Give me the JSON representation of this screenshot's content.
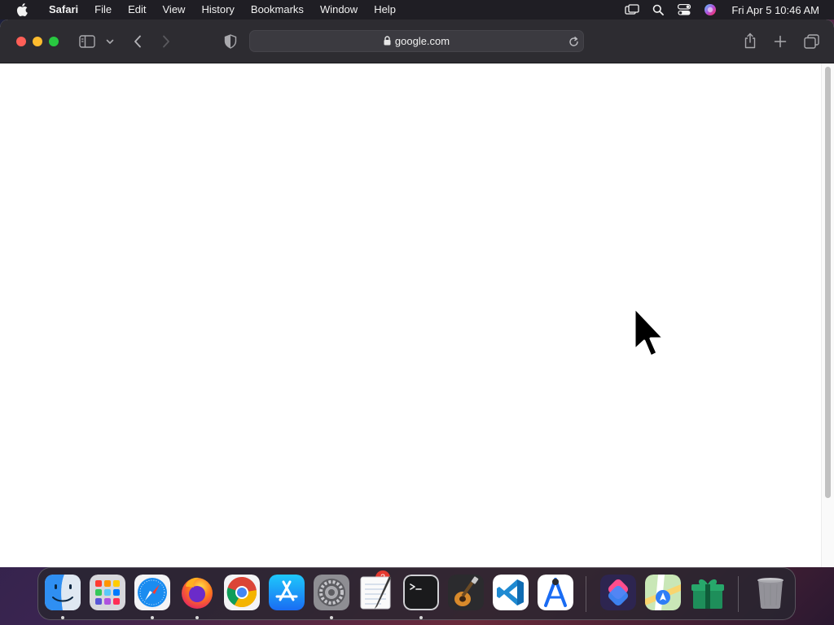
{
  "menubar": {
    "app_name": "Safari",
    "items": [
      "File",
      "Edit",
      "View",
      "History",
      "Bookmarks",
      "Window",
      "Help"
    ],
    "clock": "Fri Apr 5  10:46 AM",
    "status_icons": [
      "screen-mirroring-icon",
      "spotlight-search-icon",
      "control-center-icon",
      "siri-icon"
    ]
  },
  "browser": {
    "url": "google.com",
    "toolbar_icons": [
      "sidebar-icon",
      "chevron-down-icon",
      "back-icon",
      "forward-icon",
      "privacy-shield-icon",
      "reload-icon",
      "share-icon",
      "new-tab-icon",
      "tab-overview-icon"
    ]
  },
  "dock": {
    "apps": [
      {
        "name": "Finder",
        "icon": "finder-icon",
        "running": true
      },
      {
        "name": "Launchpad",
        "icon": "launchpad-icon",
        "running": false
      },
      {
        "name": "Safari",
        "icon": "safari-icon",
        "running": true
      },
      {
        "name": "Firefox",
        "icon": "firefox-icon",
        "running": true
      },
      {
        "name": "Google Chrome",
        "icon": "chrome-icon",
        "running": false
      },
      {
        "name": "App Store",
        "icon": "app-store-icon",
        "running": false
      },
      {
        "name": "System Settings",
        "icon": "system-settings-icon",
        "running": true,
        "badge": "2"
      },
      {
        "name": "TextEdit",
        "icon": "textedit-icon",
        "running": false
      },
      {
        "name": "Terminal",
        "icon": "terminal-icon",
        "running": true
      },
      {
        "name": "GarageBand",
        "icon": "garageband-icon",
        "running": false
      },
      {
        "name": "Visual Studio Code",
        "icon": "vscode-icon",
        "running": false
      },
      {
        "name": "Instruments",
        "icon": "instruments-icon",
        "running": false
      },
      {
        "name": "Shortcuts",
        "icon": "shortcuts-icon",
        "running": false
      },
      {
        "name": "Maps",
        "icon": "maps-icon",
        "running": false
      },
      {
        "name": "Gift",
        "icon": "gift-icon",
        "running": false
      },
      {
        "name": "Trash",
        "icon": "trash-icon",
        "running": false
      }
    ]
  },
  "colors": {
    "close": "#ff5f57",
    "minimize": "#febc2e",
    "zoom": "#28c840",
    "badge": "#e5392f"
  }
}
